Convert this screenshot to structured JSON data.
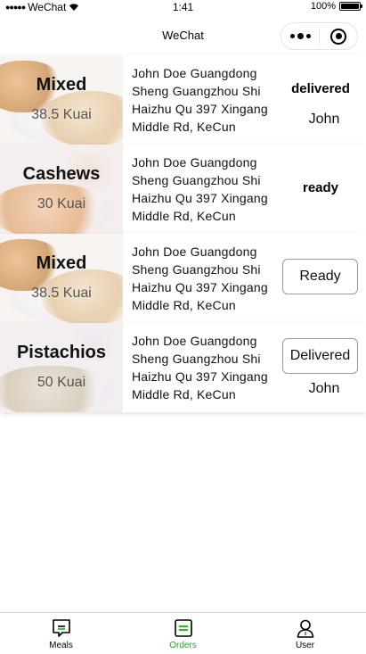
{
  "status_bar": {
    "carrier": "WeChat",
    "time": "1:41",
    "battery": "100%"
  },
  "nav": {
    "title": "WeChat"
  },
  "orders": [
    {
      "product": "Mixed",
      "price": "38.5 Kuai",
      "address": "John Doe Guangdong Sheng Guangzhou Shi Haizhu Qu 397 Xingang Middle Rd, KeCun",
      "status": "delivered",
      "receiver": "John"
    },
    {
      "product": "Cashews",
      "price": "30 Kuai",
      "address": "John Doe Guangdong Sheng Guangzhou Shi Haizhu Qu 397 Xingang Middle Rd, KeCun",
      "status": "ready"
    },
    {
      "product": "Mixed",
      "price": "38.5 Kuai",
      "address": "John Doe Guangdong Sheng Guangzhou Shi Haizhu Qu 397 Xingang Middle Rd, KeCun",
      "action_button": "Ready"
    },
    {
      "product": "Pistachios",
      "price": "50 Kuai",
      "address": "John Doe Guangdong Sheng Guangzhou Shi Haizhu Qu 397 Xingang Middle Rd, KeCun",
      "action_button": "Delivered",
      "receiver": "John"
    }
  ],
  "tabbar": {
    "items": [
      {
        "label": "Meals",
        "icon": "meals-icon"
      },
      {
        "label": "Orders",
        "icon": "orders-icon",
        "active": true
      },
      {
        "label": "User",
        "icon": "user-icon"
      }
    ],
    "active_color": "#1aad19"
  }
}
